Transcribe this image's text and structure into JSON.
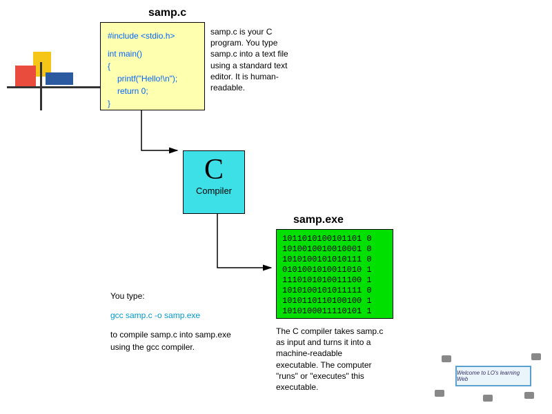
{
  "source": {
    "title": "samp.c",
    "line1": "#include <stdio.h>",
    "line2": "int main()",
    "line3": "{",
    "line4": "printf(\"Hello!\\n\");",
    "line5": "return 0;",
    "line6": "}",
    "description": "samp.c is your C program. You type samp.c into a text file using a standard text editor. It is human-readable."
  },
  "compiler": {
    "bigLetter": "C",
    "label": "Compiler"
  },
  "exe": {
    "title": "samp.exe",
    "bin1": "1011010100101101 0",
    "bin2": "1010010010010001 0",
    "bin3": "1010100101010111 0",
    "bin4": "0101001010011010 1",
    "bin5": "1110101010011100 1",
    "bin6": "1010100101011111 0",
    "bin7": "1010110110100100 1",
    "bin8": "1010100011110101 1",
    "description": "The C compiler takes samp.c as input and turns it into a machine-readable executable. The computer \"runs\" or \"executes\" this executable."
  },
  "command": {
    "intro": "You type:",
    "cmd": "gcc samp.c -o samp.exe",
    "outro": "to compile samp.c into samp.exe using the gcc compiler."
  },
  "footer": {
    "text": "Welcome to LO's learning Web"
  }
}
